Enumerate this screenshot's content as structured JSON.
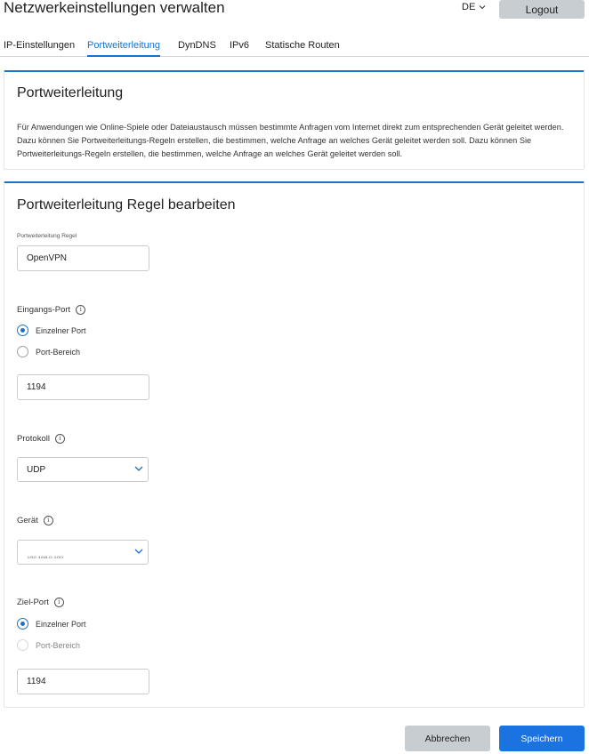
{
  "header": {
    "title": "Netzwerkeinstellungen verwalten",
    "language": "DE",
    "logout_label": "Logout"
  },
  "tabs": [
    {
      "label": "IP-Einstellungen",
      "active": false
    },
    {
      "label": "Portweiterleitung",
      "active": true
    },
    {
      "label": "DynDNS",
      "active": false
    },
    {
      "label": "IPv6",
      "active": false
    },
    {
      "label": "Statische Routen",
      "active": false
    }
  ],
  "info_card": {
    "title": "Portweiterleitung",
    "description": "Für Anwendungen wie Online-Spiele oder Dateiaustausch müssen bestimmte Anfragen vom Internet direkt zum entsprechenden Gerät geleitet werden. Dazu können Sie Portweiterleitungs-Regeln erstellen, die bestimmen, welche Anfrage an welches Gerät geleitet werden soll. Dazu können Sie Portweiterleitungs-Regeln erstellen, die bestimmen, welche Anfrage an welches Gerät geleitet werden soll."
  },
  "edit_card": {
    "title": "Portweiterleitung Regel bearbeiten",
    "rule_label": "Portweiterleitung Regel",
    "rule_value": "OpenVPN",
    "input_port": {
      "label": "Eingangs-Port",
      "option_single": "Einzelner Port",
      "option_range": "Port-Bereich",
      "selected": "Einzelner Port",
      "value": "1194"
    },
    "protocol": {
      "label": "Protokoll",
      "value": "UDP"
    },
    "device": {
      "label": "Gerät",
      "value": "192.168.0.100"
    },
    "target_port": {
      "label": "Ziel-Port",
      "option_single": "Einzelner Port",
      "option_range": "Port-Bereich",
      "selected": "Einzelner Port",
      "value": "1194"
    }
  },
  "footer": {
    "cancel_label": "Abbrechen",
    "save_label": "Speichern"
  },
  "colors": {
    "accent": "#1a73c8",
    "save_button": "#1a73e0",
    "secondary_button": "#c8cdd2",
    "divider": "#d0d4d8"
  }
}
